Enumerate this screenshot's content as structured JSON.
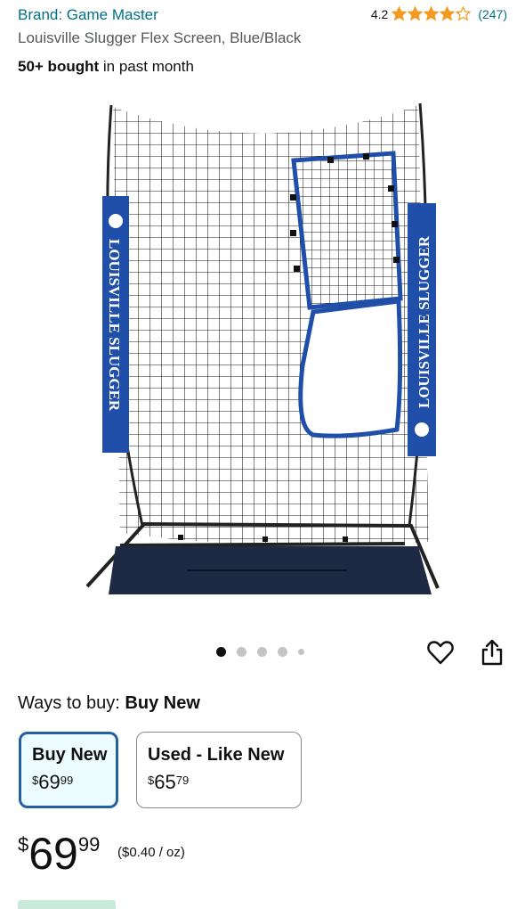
{
  "header": {
    "brand": "Brand: Game Master",
    "rating_value": "4.2",
    "rating_stars": 4.2,
    "rating_count": "(247)",
    "star_color": "#f29a21"
  },
  "product": {
    "title": "Louisville Slugger Flex Screen, Blue/Black",
    "bought_bold": "50+ bought",
    "bought_rest": " in past month",
    "image_icon": "pitching-screen-net-image",
    "banner_text": "LOUISVILLE SLUGGER"
  },
  "gallery": {
    "dot_count": 5,
    "active_index": 0
  },
  "actions": {
    "wishlist_icon": "heart-icon",
    "share_icon": "share-icon"
  },
  "ways_to_buy": {
    "label": "Ways to buy:",
    "selected": "Buy New"
  },
  "options": [
    {
      "label": "Buy New",
      "price_symbol": "$",
      "price_whole": "69",
      "price_fraction": "99",
      "selected": true
    },
    {
      "label": "Used - Like New",
      "price_symbol": "$",
      "price_whole": "65",
      "price_fraction": "79",
      "selected": false
    }
  ],
  "price": {
    "symbol": "$",
    "whole": "69",
    "fraction": "99",
    "unit_price": "($0.40 / oz)"
  },
  "colors": {
    "link": "#007185",
    "selected_border": "#2162a1",
    "selected_bg": "#edfdff",
    "net_blue": "#1f4fa8"
  }
}
